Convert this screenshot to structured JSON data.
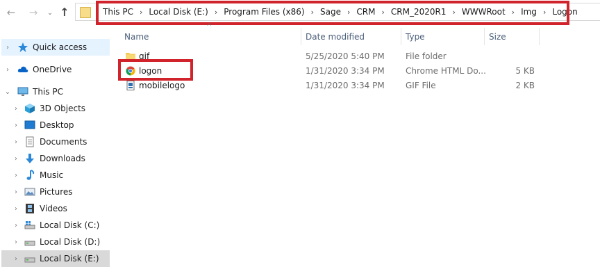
{
  "address_bar": {
    "breadcrumb": [
      "This PC",
      "Local Disk (E:)",
      "Program Files (x86)",
      "Sage",
      "CRM",
      "CRM_2020R1",
      "WWWRoot",
      "Img",
      "Logon"
    ],
    "separator": "›"
  },
  "columns": {
    "name": "Name",
    "date_modified": "Date modified",
    "type": "Type",
    "size": "Size"
  },
  "files": [
    {
      "name": "gif",
      "date": "5/25/2020 5:40 PM",
      "type": "File folder",
      "size": "",
      "icon": "folder-icon"
    },
    {
      "name": "logon",
      "date": "1/31/2020 3:34 PM",
      "type": "Chrome HTML Do...",
      "size": "5 KB",
      "icon": "chrome-icon"
    },
    {
      "name": "mobilelogo",
      "date": "1/31/2020 3:34 PM",
      "type": "GIF File",
      "size": "2 KB",
      "icon": "gif-file-icon"
    }
  ],
  "sidebar": {
    "quick_access": "Quick access",
    "onedrive": "OneDrive",
    "this_pc": "This PC",
    "items": [
      "3D Objects",
      "Desktop",
      "Documents",
      "Downloads",
      "Music",
      "Pictures",
      "Videos",
      "Local Disk (C:)",
      "Local Disk (D:)",
      "Local Disk (E:)"
    ]
  },
  "colors": {
    "highlight_box": "#d0232b",
    "selected_bg": "#d9d9d9",
    "hover_bg": "#e5f3ff",
    "header_text": "#4c607a"
  }
}
